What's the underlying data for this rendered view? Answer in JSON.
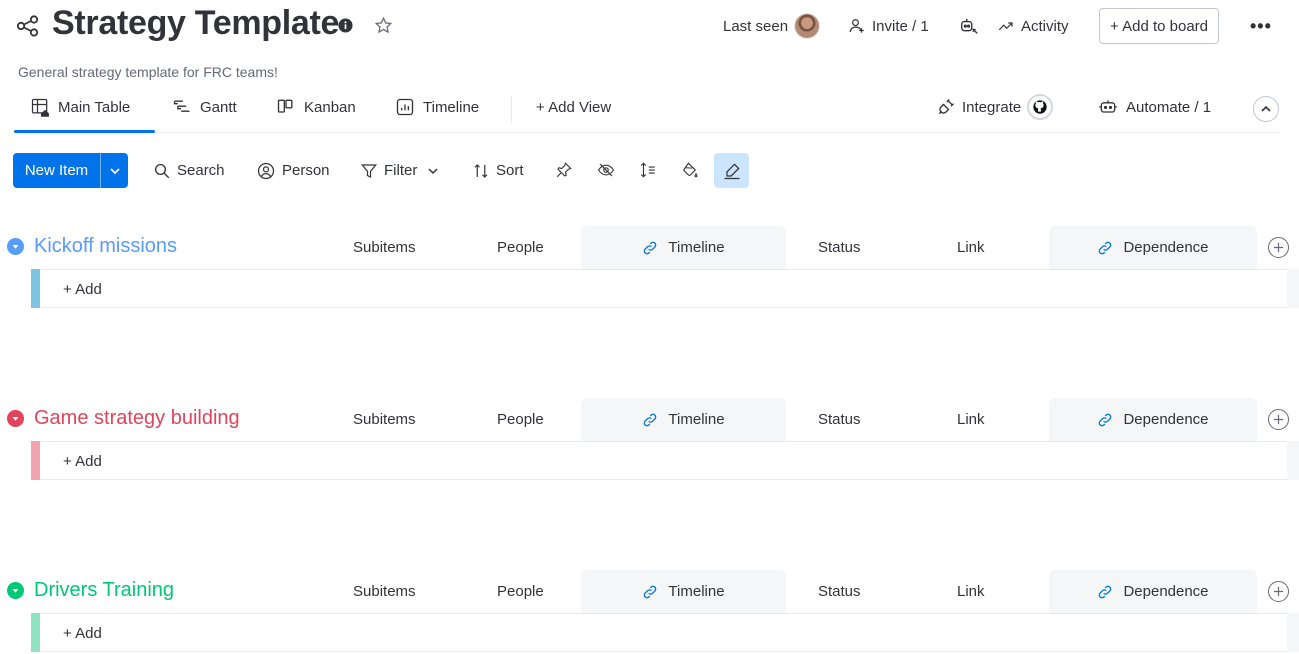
{
  "header": {
    "title": "Strategy Template",
    "description": "General strategy template for FRC teams!",
    "last_seen_label": "Last seen",
    "invite_label": "Invite / 1",
    "activity_label": "Activity",
    "add_to_board_label": "+ Add to board",
    "more_label": "•••"
  },
  "tabs": {
    "main_table": "Main Table",
    "gantt": "Gantt",
    "kanban": "Kanban",
    "timeline": "Timeline",
    "add_view": "+ Add View",
    "integrate": "Integrate",
    "automate": "Automate / 1"
  },
  "toolbar": {
    "new_item": "New Item",
    "search": "Search",
    "person": "Person",
    "filter": "Filter",
    "sort": "Sort"
  },
  "columns": {
    "subitems": "Subitems",
    "people": "People",
    "timeline": "Timeline",
    "status": "Status",
    "link": "Link",
    "dependence": "Dependence"
  },
  "groups": [
    {
      "title": "Kickoff missions",
      "color": "#579bfc",
      "bar_color": "#7ec3e0",
      "add_label": "+ Add"
    },
    {
      "title": "Game strategy building",
      "color": "#e2445c",
      "bar_color": "#f2a4ae",
      "add_label": "+ Add"
    },
    {
      "title": "Drivers Training",
      "color": "#00c875",
      "bar_color": "#8fe3c0",
      "add_label": "+ Add"
    }
  ],
  "colors": {
    "accent": "#0073ea",
    "toolbar_active": "#cce5ff",
    "shaded_column": "#f5f6f8"
  }
}
